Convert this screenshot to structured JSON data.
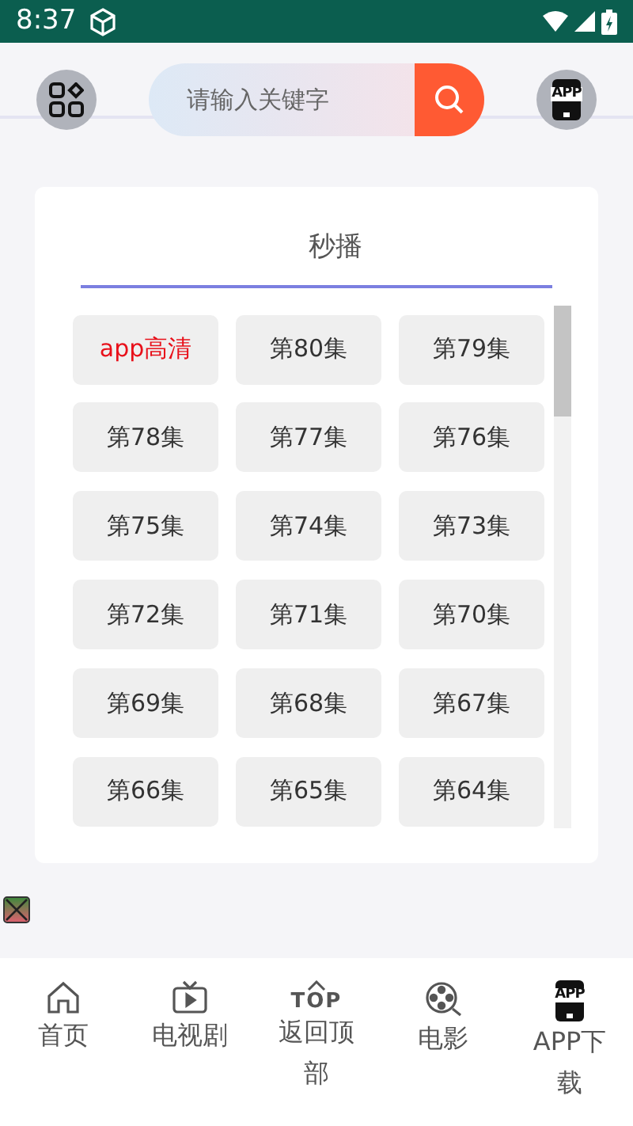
{
  "status_bar": {
    "time": "8:37"
  },
  "search": {
    "placeholder": "请输入关键字"
  },
  "app_button": {
    "icon_text": "APP"
  },
  "player_card": {
    "title": "秒播",
    "episodes": [
      {
        "label": "app高清",
        "kind": "promo"
      },
      {
        "label": "第80集",
        "kind": "episode"
      },
      {
        "label": "第79集",
        "kind": "episode"
      },
      {
        "label": "第78集",
        "kind": "episode"
      },
      {
        "label": "第77集",
        "kind": "episode"
      },
      {
        "label": "第76集",
        "kind": "episode"
      },
      {
        "label": "第75集",
        "kind": "episode"
      },
      {
        "label": "第74集",
        "kind": "episode"
      },
      {
        "label": "第73集",
        "kind": "episode"
      },
      {
        "label": "第72集",
        "kind": "episode"
      },
      {
        "label": "第71集",
        "kind": "episode"
      },
      {
        "label": "第70集",
        "kind": "episode"
      },
      {
        "label": "第69集",
        "kind": "episode"
      },
      {
        "label": "第68集",
        "kind": "episode"
      },
      {
        "label": "第67集",
        "kind": "episode"
      },
      {
        "label": "第66集",
        "kind": "episode"
      },
      {
        "label": "第65集",
        "kind": "episode"
      },
      {
        "label": "第64集",
        "kind": "episode"
      }
    ]
  },
  "bottom_nav": [
    {
      "label": "首页",
      "kind": "plain"
    },
    {
      "label": "电视剧",
      "kind": "plain"
    },
    {
      "label": "返回顶部",
      "kind": "top",
      "icon_text": "TOP"
    },
    {
      "label": "电影",
      "kind": "plain"
    },
    {
      "label": "APP下载",
      "kind": "app",
      "icon_text": "APP"
    }
  ]
}
